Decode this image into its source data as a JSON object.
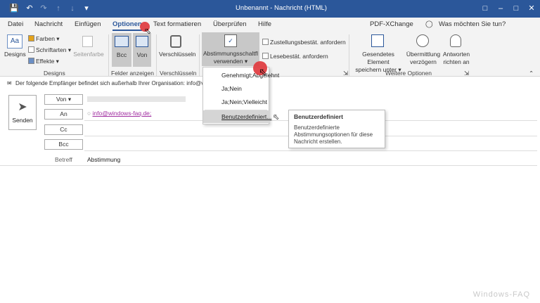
{
  "window": {
    "title": "Unbenannt - Nachricht (HTML)",
    "accent": "#2b579a"
  },
  "tabs": [
    {
      "label": "Datei"
    },
    {
      "label": "Nachricht"
    },
    {
      "label": "Einfügen"
    },
    {
      "label": "Optionen"
    },
    {
      "label": "Text formatieren"
    },
    {
      "label": "Überprüfen"
    },
    {
      "label": "Hilfe"
    },
    {
      "label": "PDF-XChange"
    },
    {
      "label": "Was möchten Sie tun?"
    }
  ],
  "ribbon": {
    "designs": {
      "label": "Designs",
      "farben": "Farben",
      "schriftarten": "Schriftarten",
      "effekte": "Effekte",
      "seitenfarbe": "Seitenfarbe",
      "group": "Designs"
    },
    "felder": {
      "bcc": "Bcc",
      "von": "Von",
      "group": "Felder anzeigen"
    },
    "verschluesseln": {
      "label": "Verschlüsseln",
      "group": "Verschlüsseln"
    },
    "abstimmung": {
      "line1": "Abstimmungsschaltfl",
      "line2": "verwenden",
      "zustellung": "Zustellungsbestät. anfordern",
      "lese": "Lesebestät. anfordern"
    },
    "weitere": {
      "gesendetes_1": "Gesendetes Element",
      "gesendetes_2": "speichern unter",
      "uebermittlung_1": "Übermittlung",
      "uebermittlung_2": "verzögern",
      "antworten_1": "Antworten",
      "antworten_2": "richten an",
      "group": "Weitere Optionen"
    }
  },
  "infobar": {
    "text": "Der folgende Empfänger befindet sich außerhalb Ihrer Organisation: info@v"
  },
  "compose": {
    "send": "Senden",
    "von": "Von",
    "an": "An",
    "cc": "Cc",
    "bcc": "Bcc",
    "recipient": "info@windows-faq.de;",
    "betreff_label": "Betreff",
    "betreff_value": "Abstimmung"
  },
  "dropdown": {
    "items": [
      {
        "label": "Genehmigt;Abgelehnt"
      },
      {
        "label": "Ja;Nein"
      },
      {
        "label": "Ja;Nein;Vielleicht"
      },
      {
        "label": "Benutzerdefiniert..."
      }
    ]
  },
  "tooltip": {
    "title": "Benutzerdefiniert",
    "body": "Benutzerdefinierte Abstimmungsoptionen für diese Nachricht erstellen."
  },
  "watermark": "Windows-FAQ"
}
